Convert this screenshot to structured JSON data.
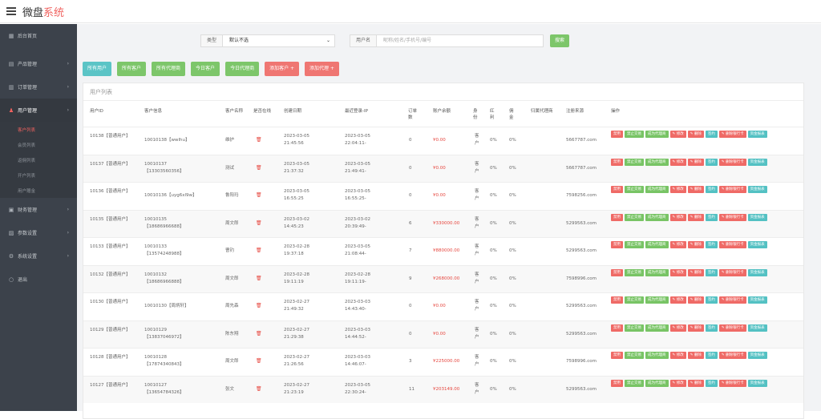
{
  "app": {
    "brand_main": "微盘",
    "brand_accent": "系统"
  },
  "sidebar": {
    "items": [
      {
        "label": "后台首页",
        "icon": "dashboard-icon"
      },
      {
        "label": "产品管理",
        "icon": "product-icon"
      },
      {
        "label": "订单管理",
        "icon": "order-icon"
      },
      {
        "label": "用户管理",
        "icon": "user-icon"
      },
      {
        "label": "财务管理",
        "icon": "finance-icon"
      },
      {
        "label": "参数设置",
        "icon": "param-icon"
      },
      {
        "label": "系统设置",
        "icon": "system-icon"
      },
      {
        "label": "退出",
        "icon": "logout-icon"
      }
    ],
    "sub_items": [
      "客户列表",
      "会员列表",
      "返佣列表",
      "开户列表",
      "用户赠金"
    ]
  },
  "filter": {
    "type_label": "类型",
    "type_value": "默认不选",
    "user_label": "用户名",
    "user_placeholder": "昵称/姓名/手机号/编号",
    "search_label": "搜索"
  },
  "quick": [
    "所有用户",
    "所有客户",
    "所有代理商",
    "今日客户",
    "今日代理商",
    "添加客户 +",
    "添加代理 +"
  ],
  "list_title": "用户列表",
  "headers": {
    "uid": "用户ID",
    "info": "客户信息",
    "name": "客户名称",
    "online": "是否在线",
    "created": "创建日期",
    "login": "最近登录-IP",
    "orders": "订单数",
    "balance": "账户余额",
    "identity": "身份",
    "bonus": "红利",
    "commission": "佣金",
    "agent": "归属代理商",
    "source": "注册来源",
    "ops": "操作"
  },
  "ops_labels": [
    "禁用",
    "禁止交易",
    "成为代理商",
    "✎ 修改",
    "✎ 删除",
    "签约",
    "✎ 删除银行卡",
    "资金报表"
  ],
  "rows": [
    {
      "uid": "10138【普通用户】",
      "info1": "10010138【wwlhu】",
      "info2": "",
      "name": "维护",
      "cdate": "2023-03-05",
      "ctime": "21:45:56",
      "ldate": "2023-03-05",
      "ltime": "22:04:11-",
      "orders": "0",
      "balance": "¥0.00",
      "identity": "客户",
      "bonus": "0%",
      "commission": "0%",
      "source": "5667787.com"
    },
    {
      "uid": "10137【普通用户】",
      "info1": "10010137",
      "info2": "【13303560356】",
      "name": "测试",
      "cdate": "2023-03-05",
      "ctime": "21:37:32",
      "ldate": "2023-03-05",
      "ltime": "21:49:41-",
      "orders": "0",
      "balance": "¥0.00",
      "identity": "客户",
      "bonus": "0%",
      "commission": "0%",
      "source": "5667787.com"
    },
    {
      "uid": "10136【普通用户】",
      "info1": "10010136【uyg6xl9w】",
      "info2": "",
      "name": "鲁阳玛",
      "cdate": "2023-03-05",
      "ctime": "16:55:25",
      "ldate": "2023-03-05",
      "ltime": "16:55:25-",
      "orders": "0",
      "balance": "¥0.00",
      "identity": "客户",
      "bonus": "0%",
      "commission": "0%",
      "source": "7598256.com"
    },
    {
      "uid": "10135【普通用户】",
      "info1": "10010135",
      "info2": "【18686966688】",
      "name": "周文郎",
      "cdate": "2023-03-02",
      "ctime": "14:45:23",
      "ldate": "2023-03-02",
      "ltime": "20:39:49-",
      "orders": "6",
      "balance": "¥330000.00",
      "identity": "客户",
      "bonus": "0%",
      "commission": "0%",
      "source": "5299563.com"
    },
    {
      "uid": "10133【普通用户】",
      "info1": "10010133",
      "info2": "【13574248988】",
      "name": "曹钓",
      "cdate": "2023-02-28",
      "ctime": "19:37:18",
      "ldate": "2023-03-05",
      "ltime": "21:08:44-",
      "orders": "7",
      "balance": "¥880000.00",
      "identity": "客户",
      "bonus": "0%",
      "commission": "0%",
      "source": "5299563.com"
    },
    {
      "uid": "10132【普通用户】",
      "info1": "10010132",
      "info2": "【18686966888】",
      "name": "周文郎",
      "cdate": "2023-02-28",
      "ctime": "19:11:19",
      "ldate": "2023-02-28",
      "ltime": "19:11:19-",
      "orders": "9",
      "balance": "¥268000.00",
      "identity": "客户",
      "bonus": "0%",
      "commission": "0%",
      "source": "7598996.com"
    },
    {
      "uid": "10130【普通用户】",
      "info1": "10010130【周炳轩】",
      "info2": "",
      "name": "周先森",
      "cdate": "2023-02-27",
      "ctime": "21:49:32",
      "ldate": "2023-03-03",
      "ltime": "14:43:40-",
      "orders": "0",
      "balance": "¥0.00",
      "identity": "客户",
      "bonus": "0%",
      "commission": "0%",
      "source": "5299563.com"
    },
    {
      "uid": "10129【普通用户】",
      "info1": "10010129",
      "info2": "【13837046972】",
      "name": "陈东翔",
      "cdate": "2023-02-27",
      "ctime": "21:29:38",
      "ldate": "2023-03-03",
      "ltime": "14:44:52-",
      "orders": "0",
      "balance": "¥0.00",
      "identity": "客户",
      "bonus": "0%",
      "commission": "0%",
      "source": "5299563.com"
    },
    {
      "uid": "10128【普通用户】",
      "info1": "10010128",
      "info2": "【17874340843】",
      "name": "周文郎",
      "cdate": "2023-02-27",
      "ctime": "21:26:56",
      "ldate": "2023-03-03",
      "ltime": "14:46:07-",
      "orders": "3",
      "balance": "¥225000.00",
      "identity": "客户",
      "bonus": "0%",
      "commission": "0%",
      "source": "7598996.com"
    },
    {
      "uid": "10127【普通用户】",
      "info1": "10010127",
      "info2": "【13654784326】",
      "name": "张文",
      "cdate": "2023-02-27",
      "ctime": "21:23:19",
      "ldate": "2023-03-05",
      "ltime": "22:30:24-",
      "orders": "11",
      "balance": "¥203149.00",
      "identity": "客户",
      "bonus": "0%",
      "commission": "0%",
      "source": "5299563.com"
    }
  ],
  "colors": {
    "accent": "#f0625f",
    "sidebar": "#3c424b",
    "green": "#7dc66a",
    "teal": "#5bc4c6",
    "red": "#ef7672"
  }
}
